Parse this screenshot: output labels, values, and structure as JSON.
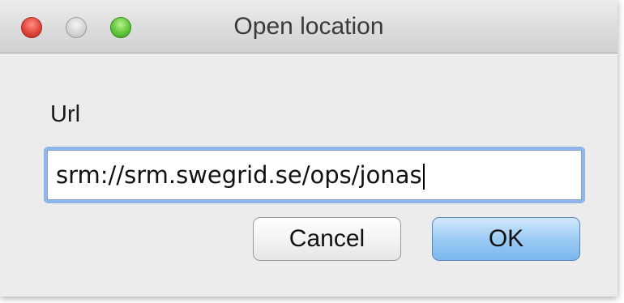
{
  "window": {
    "title": "Open location"
  },
  "form": {
    "url_label": "Url",
    "url_value": "srm://srm.swegrid.se/ops/jonas"
  },
  "buttons": {
    "cancel_label": "Cancel",
    "ok_label": "OK"
  },
  "colors": {
    "focus_ring": "#8db7ea",
    "default_button": "#9cccf4",
    "close_button": "#e0463b",
    "zoom_button": "#5fc73a"
  }
}
